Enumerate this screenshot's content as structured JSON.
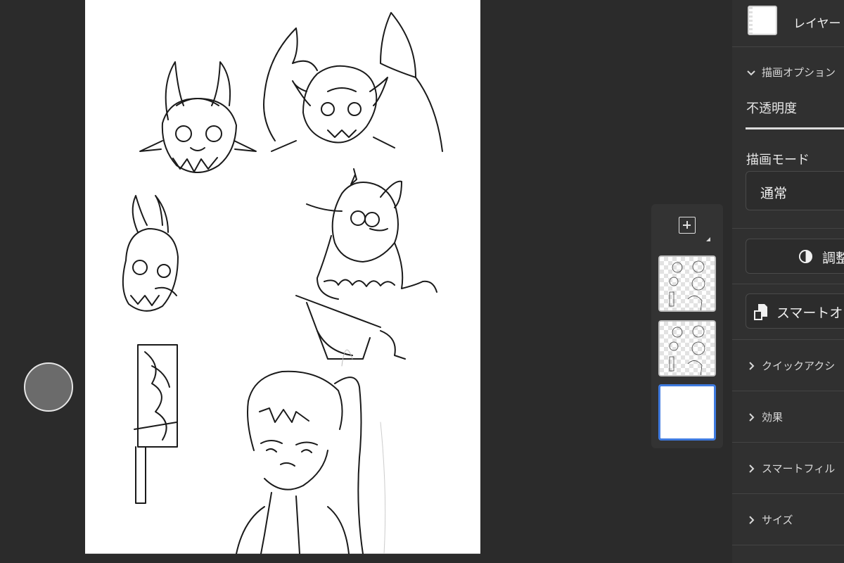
{
  "layer_header": {
    "name": "レイヤー"
  },
  "properties": {
    "drawing_options_label": "描画オプション",
    "opacity_label": "不透明度",
    "blend_mode_label": "描画モード",
    "blend_mode_value": "通常",
    "adjust_label": "調整",
    "smart_object_label": "スマートオ",
    "quick_actions_label": "クイックアクシ",
    "effects_label": "効果",
    "smart_filters_label": "スマートフィル",
    "size_label": "サイズ"
  },
  "colors": {
    "selected_layer_border": "#3f7be0",
    "panel_bg": "#303030",
    "app_bg": "#2b2b2b"
  },
  "icons": [
    "add-layer-icon",
    "chevron-down-icon",
    "chevron-right-icon",
    "adjustment-icon",
    "smart-object-icon"
  ]
}
